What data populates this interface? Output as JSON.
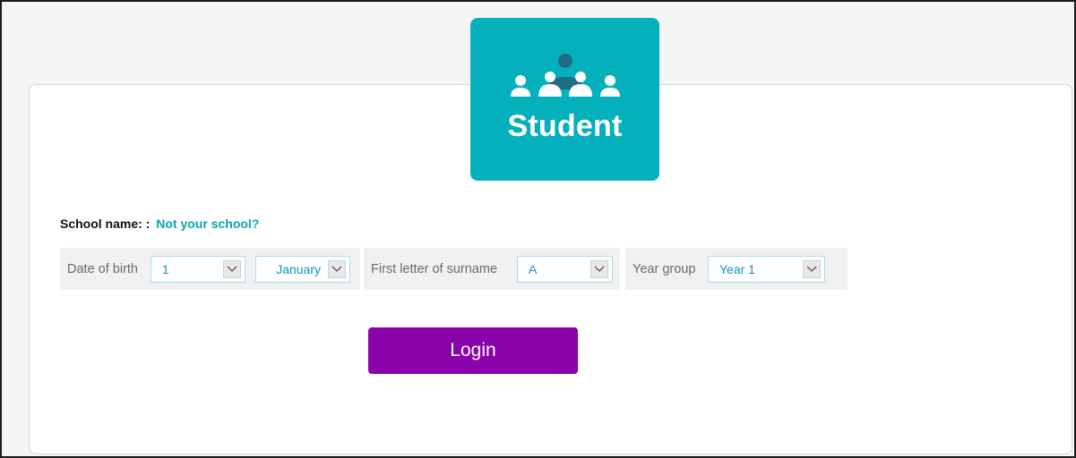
{
  "badge": {
    "title": "Student",
    "icon": "students-group-icon"
  },
  "school": {
    "label": "School name: :",
    "link": "Not your school?"
  },
  "dob": {
    "label": "Date of birth",
    "day": "1",
    "month": "January"
  },
  "surname": {
    "label": "First letter of surname",
    "value": "A"
  },
  "year": {
    "label": "Year group",
    "value": "Year 1"
  },
  "login": {
    "label": "Login"
  },
  "colors": {
    "badge": "#05b0bd",
    "link": "#0aa4b0",
    "select_text": "#1292c4",
    "button": "#8a02aa"
  }
}
